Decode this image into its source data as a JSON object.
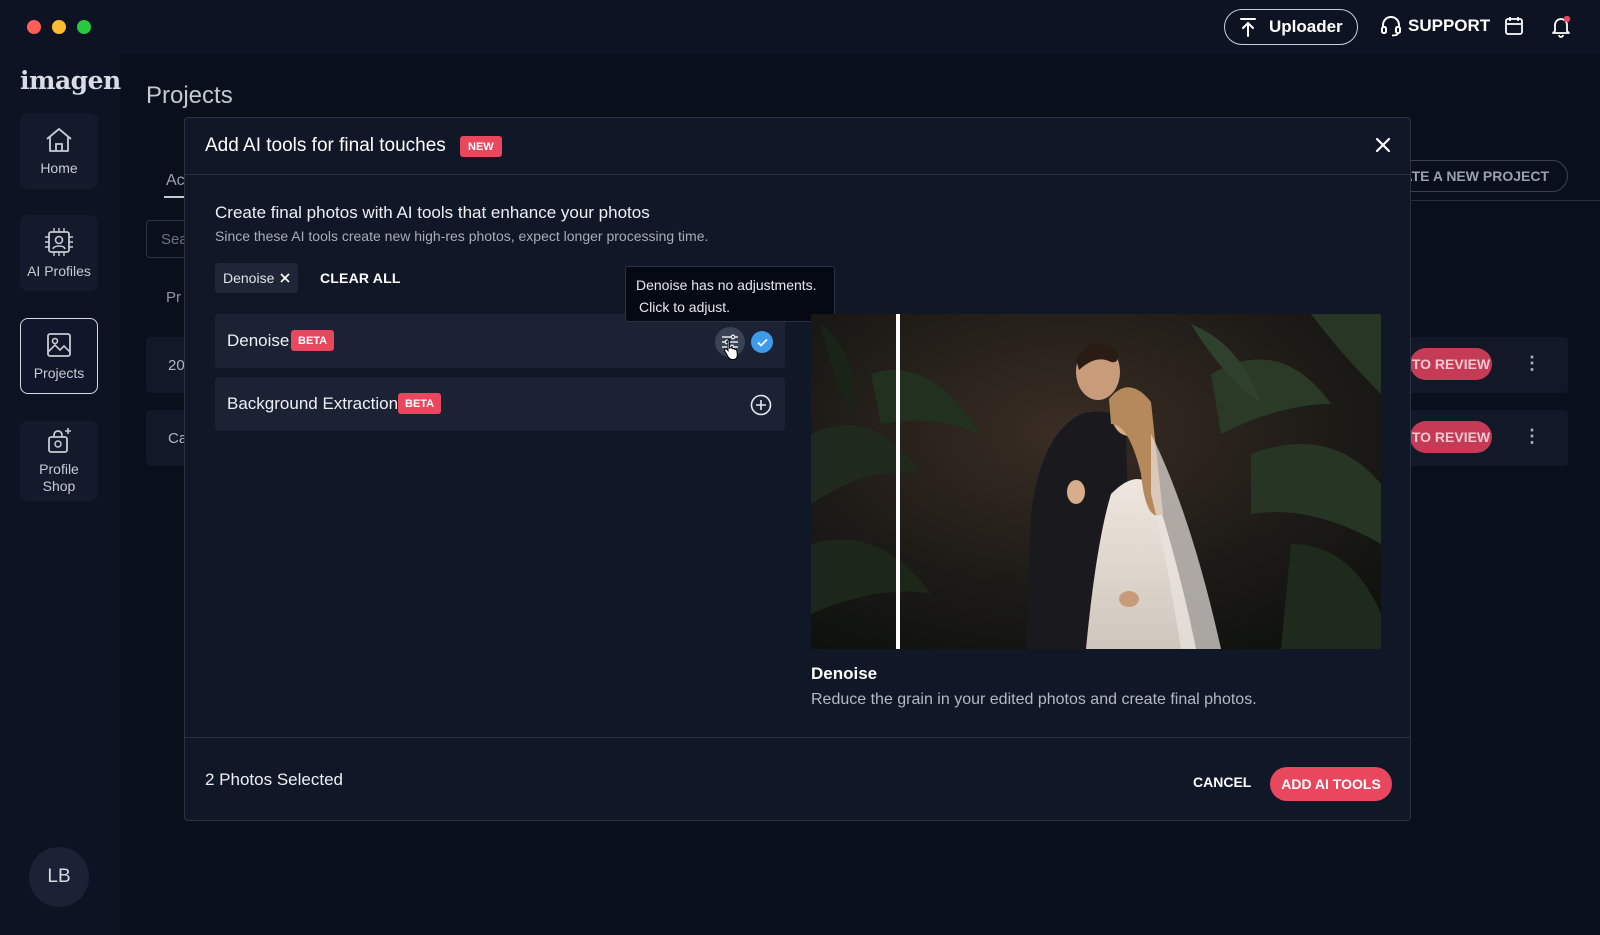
{
  "topbar": {
    "uploader_label": "Uploader",
    "support_label": "SUPPORT",
    "traffic_colors": [
      "#ff5f57",
      "#febc2e",
      "#28c840"
    ]
  },
  "sidebar": {
    "logo": "imagen",
    "items": [
      {
        "label": "Home",
        "icon": "home-icon"
      },
      {
        "label": "AI Profiles",
        "icon": "ai-profiles-icon"
      },
      {
        "label": "Projects",
        "icon": "projects-icon",
        "active": true
      },
      {
        "label": "Profile Shop",
        "icon": "profile-shop-icon"
      }
    ],
    "avatar_initials": "LB"
  },
  "background_page": {
    "title": "Projects",
    "tab_partial": "Ac",
    "search_partial": "Sea",
    "column_partial": "Pr",
    "rows": [
      {
        "partial": "20",
        "status": "TO REVIEW"
      },
      {
        "partial": "Ca",
        "status": "TO REVIEW"
      }
    ],
    "new_project_partial": "EATE A NEW PROJECT"
  },
  "modal": {
    "title": "Add AI tools for final touches",
    "new_badge": "NEW",
    "lead": "Create final photos with AI tools that enhance your photos",
    "sub": "Since these AI tools create new high-res photos, expect longer processing time.",
    "selected_chip": "Denoise",
    "clear_all": "CLEAR ALL",
    "tools": [
      {
        "name": "Denoise",
        "badge": "BETA",
        "selected": true
      },
      {
        "name": "Background Extraction",
        "badge": "BETA",
        "selected": false
      }
    ],
    "tooltip_line1": "Denoise has no adjustments.",
    "tooltip_line2": "Click to adjust.",
    "preview_title": "Denoise",
    "preview_desc": "Reduce the grain in your edited photos and create final photos.",
    "footer_count": "2 Photos Selected",
    "cancel_label": "CANCEL",
    "add_label": "ADD AI TOOLS",
    "accent_color": "#e8475e",
    "check_color": "#3d9be9"
  }
}
